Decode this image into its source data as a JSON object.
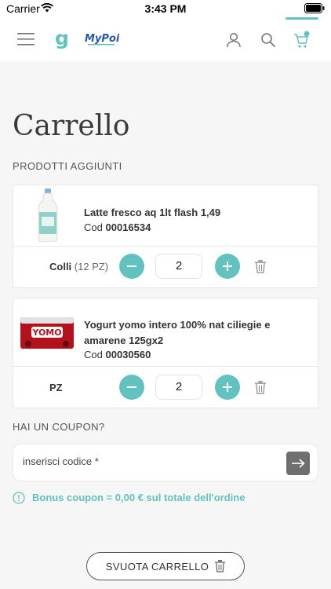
{
  "status_bar": {
    "carrier": "Carrier",
    "time": "3:43 PM"
  },
  "header": {
    "logo_main": "g",
    "logo_brand": "MyPoi"
  },
  "page": {
    "title": "Carrello",
    "products_section_label": "PRODOTTI AGGIUNTI"
  },
  "products": [
    {
      "name": "Latte fresco aq 1lt flash 1,49",
      "code_prefix": "Cod",
      "code": "00016534",
      "unit_label": "Colli",
      "unit_detail": "(12 PZ)",
      "quantity": "2"
    },
    {
      "name_line1": "Yogurt yomo intero 100% nat ciliegie e",
      "name_line2": "amarene 125gx2",
      "code_prefix": "Cod",
      "code": "00030560",
      "unit_label": "PZ",
      "unit_detail": "",
      "quantity": "2",
      "brand_text": "YOMO"
    }
  ],
  "coupon": {
    "section_label": "HAI UN COUPON?",
    "placeholder": "inserisci codice *",
    "bonus_text": "Bonus coupon = 0,00 € sul totale dell'ordine"
  },
  "actions": {
    "empty_cart_label": "SVUOTA CARRELLO"
  },
  "colors": {
    "accent": "#62c2bf",
    "text": "#333333",
    "background": "#f6f6f6"
  },
  "icons": [
    "wifi-icon",
    "battery-icon",
    "menu-icon",
    "user-icon",
    "search-icon",
    "cart-icon",
    "minus-icon",
    "plus-icon",
    "trash-icon",
    "arrow-right-icon",
    "info-icon"
  ]
}
